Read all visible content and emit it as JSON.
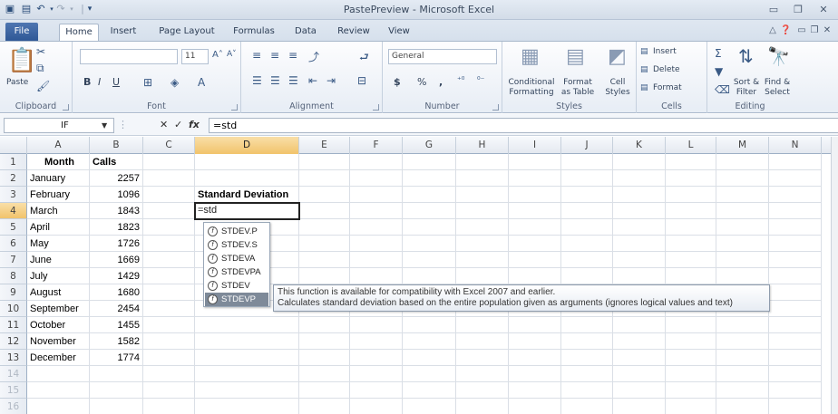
{
  "window": {
    "title": "PastePreview - Microsoft Excel"
  },
  "tabs": {
    "file": "File",
    "items": [
      "Home",
      "Insert",
      "Page Layout",
      "Formulas",
      "Data",
      "Review",
      "View"
    ],
    "active": "Home"
  },
  "ribbon": {
    "clipboard": {
      "label": "Clipboard",
      "paste": "Paste"
    },
    "font": {
      "label": "Font",
      "size": "11",
      "bold": "B",
      "italic": "I",
      "underline": "U"
    },
    "alignment": {
      "label": "Alignment"
    },
    "number": {
      "label": "Number",
      "format": "General",
      "currency": "$",
      "percent": "%",
      "comma": ","
    },
    "styles": {
      "label": "Styles",
      "conditional1": "Conditional",
      "conditional2": "Formatting",
      "format_table1": "Format",
      "format_table2": "as Table",
      "cell_styles1": "Cell",
      "cell_styles2": "Styles"
    },
    "cells": {
      "label": "Cells",
      "insert": "Insert",
      "delete": "Delete",
      "format": "Format"
    },
    "editing": {
      "label": "Editing",
      "sort1": "Sort &",
      "sort2": "Filter",
      "find1": "Find &",
      "find2": "Select"
    }
  },
  "formula_bar": {
    "name_box": "IF",
    "fx": "fx",
    "formula": "=std"
  },
  "columns": [
    "A",
    "B",
    "C",
    "D",
    "E",
    "F",
    "G",
    "H",
    "I",
    "J",
    "K",
    "L",
    "M",
    "N"
  ],
  "rows": [
    {
      "n": "1",
      "a": "Month",
      "b": "Calls"
    },
    {
      "n": "2",
      "a": "January",
      "b": "2257"
    },
    {
      "n": "3",
      "a": "February",
      "b": "1096"
    },
    {
      "n": "4",
      "a": "March",
      "b": "1843"
    },
    {
      "n": "5",
      "a": "April",
      "b": "1823"
    },
    {
      "n": "6",
      "a": "May",
      "b": "1726"
    },
    {
      "n": "7",
      "a": "June",
      "b": "1669"
    },
    {
      "n": "8",
      "a": "July",
      "b": "1429"
    },
    {
      "n": "9",
      "a": "August",
      "b": "1680"
    },
    {
      "n": "10",
      "a": "September",
      "b": "2454"
    },
    {
      "n": "11",
      "a": "October",
      "b": "1455"
    },
    {
      "n": "12",
      "a": "November",
      "b": "1582"
    },
    {
      "n": "13",
      "a": "December",
      "b": "1774"
    },
    {
      "n": "14",
      "a": "",
      "b": ""
    },
    {
      "n": "15",
      "a": "",
      "b": ""
    },
    {
      "n": "16",
      "a": "",
      "b": ""
    }
  ],
  "d3": "Standard Deviation",
  "active_cell_value": "=std",
  "autocomplete": [
    "STDEV.P",
    "STDEV.S",
    "STDEVA",
    "STDEVPA",
    "STDEV",
    "STDEVP"
  ],
  "autocomplete_selected": "STDEVP",
  "tooltip": {
    "line1": "This function is available for compatibility with Excel 2007 and earlier.",
    "line2": "Calculates standard deviation based on the entire population given as arguments (ignores logical values and text)"
  }
}
